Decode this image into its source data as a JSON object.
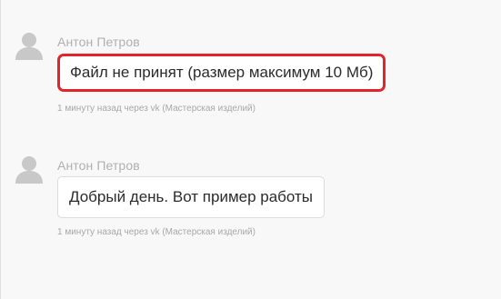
{
  "messages": [
    {
      "author": "Антон Петров",
      "text": "Файл не принят (размер максимум 10 Мб)",
      "meta": "1 минуту назад через vk (Мастерская изделий)",
      "highlighted": true
    },
    {
      "author": "Антон Петров",
      "text": "Добрый день. Вот пример работы",
      "meta": "1 минуту назад через vk (Мастерская изделий)",
      "highlighted": false
    }
  ],
  "colors": {
    "highlight_border": "#e0252b",
    "author_text": "#b0b0b0",
    "meta_text": "#a8a8a8",
    "bubble_background": "#ffffff",
    "page_background": "#f8f8f8"
  },
  "icons": {
    "avatar": "user-silhouette-icon"
  }
}
